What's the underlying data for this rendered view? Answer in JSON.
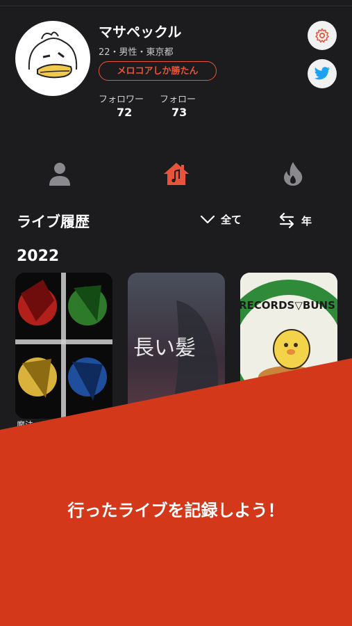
{
  "profile": {
    "username": "マサペックル",
    "meta": "22・男性・東京都",
    "badge": "メロコアしか勝たん",
    "followers_label": "フォロワー",
    "followers_count": "72",
    "following_label": "フォロー",
    "following_count": "73"
  },
  "actions": {
    "settings_icon": "gear-icon",
    "twitter_icon": "twitter-icon"
  },
  "tabs": [
    {
      "icon": "person-icon",
      "active": false
    },
    {
      "icon": "home-music-icon",
      "active": true
    },
    {
      "icon": "flame-icon",
      "active": false
    }
  ],
  "history": {
    "title": "ライブ履歴",
    "filter_label": "全て",
    "sort_label": "年",
    "year": "2022",
    "cards": [
      {
        "art": "four-panel-anime-art"
      },
      {
        "art": "nagai-kami-art",
        "art_text": "長い髪"
      },
      {
        "art": "records-buns-art",
        "art_text": "RECORDS▽BUNS R"
      }
    ],
    "first_card_label": "魔法"
  },
  "promo": {
    "text": "行ったライブを記録しよう！"
  },
  "colors": {
    "accent": "#e8543a",
    "promo_bg": "#d4381b",
    "bg": "#1c1c1e",
    "twitter": "#1da1f2"
  }
}
